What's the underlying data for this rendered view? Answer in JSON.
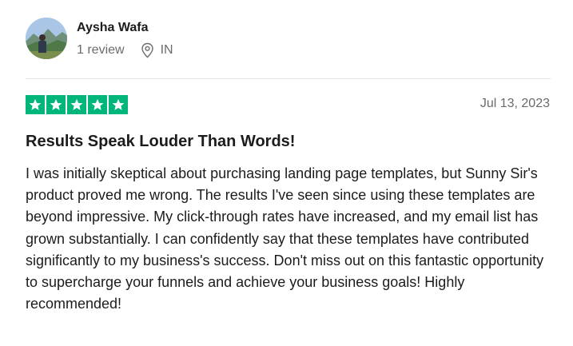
{
  "reviewer": {
    "name": "Aysha Wafa",
    "review_count": "1 review",
    "country": "IN",
    "avatar_icon": "user-photo"
  },
  "review": {
    "rating": 5,
    "rating_max": 5,
    "star_color": "#00b67a",
    "date": "Jul 13, 2023",
    "title": "Results Speak Louder Than Words!",
    "body": "I was initially skeptical about purchasing landing page templates, but Sunny Sir's product proved me wrong. The results I've seen since using these templates are beyond impressive. My click-through rates have increased, and my email list has grown substantially. I can confidently say that these templates have contributed significantly to my business's success. Don't miss out on this fantastic opportunity to supercharge your funnels and achieve your business goals! Highly recommended!"
  },
  "icons": {
    "location": "location-pin-icon",
    "star": "star-icon"
  }
}
